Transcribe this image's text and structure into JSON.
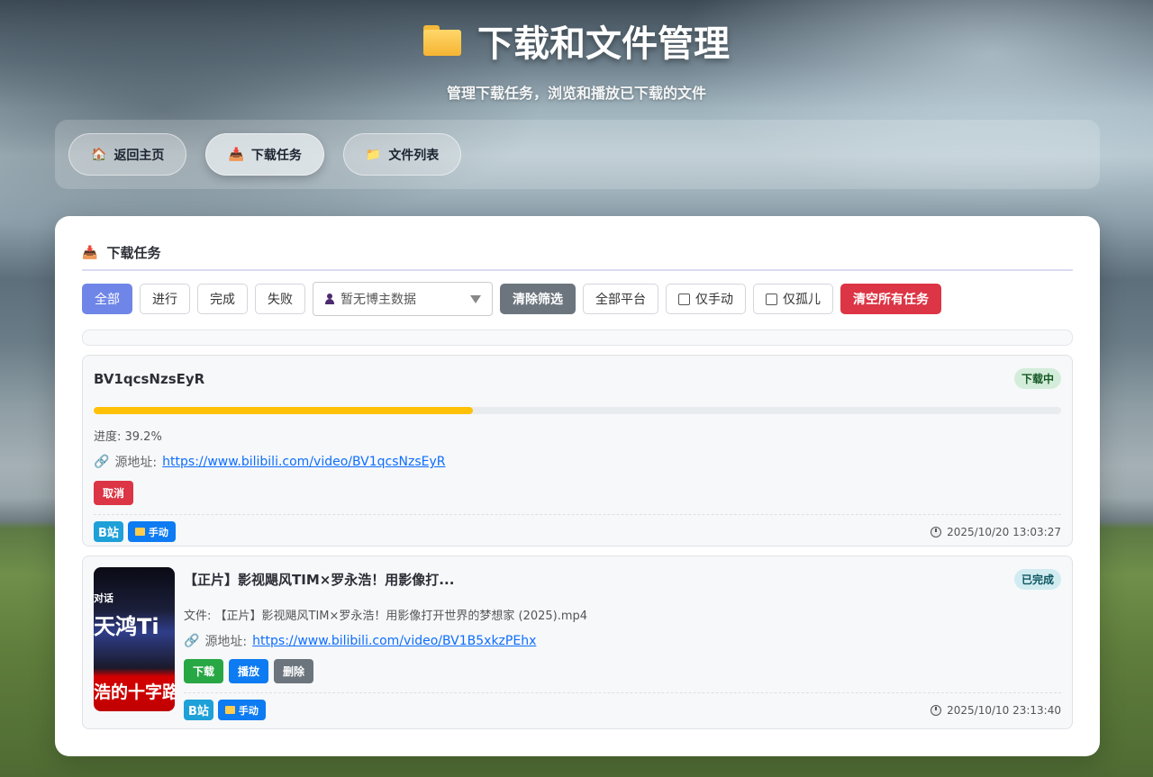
{
  "header": {
    "title": "下载和文件管理",
    "subtitle": "管理下载任务，浏览和播放已下载的文件"
  },
  "nav": {
    "items": [
      {
        "label": "返回主页",
        "icon": "house-icon"
      },
      {
        "label": "下载任务",
        "icon": "inbox-tray-icon",
        "active": true
      },
      {
        "label": "文件列表",
        "icon": "folder-icon"
      }
    ]
  },
  "panel": {
    "title": "下载任务",
    "filters": {
      "all": "全部",
      "in_progress": "进行",
      "done": "完成",
      "failed": "失败",
      "uploader_placeholder": "暂无博主数据",
      "clear_filter": "清除筛选",
      "all_platforms": "全部平台",
      "manual_only": "仅手动",
      "orphan_only": "仅孤儿",
      "clear_all": "清空所有任务"
    },
    "tasks": [
      {
        "title": "BV1qcsNzsEyR",
        "status": "下载中",
        "progress": 0.392,
        "progress_text": "进度: 39.2%",
        "source_label": "源地址:",
        "source_url": "https://www.bilibili.com/video/BV1qcsNzsEyR",
        "actions": [
          "取消"
        ],
        "platform_tag": "B站",
        "manual_tag": "手动",
        "time": "2025/10/20 13:03:27"
      },
      {
        "title": "【正片】影视飓风TIM×罗永浩！用影像打...",
        "status": "已完成",
        "file_text": "文件: 【正片】影视飓风TIM×罗永浩！用影像打开世界的梦想家 (2025).mp4",
        "source_label": "源地址:",
        "source_url": "https://www.bilibili.com/video/BV1B5xkzPEhx",
        "actions": [
          "下载",
          "播放",
          "删除"
        ],
        "platform_tag": "B站",
        "manual_tag": "手动",
        "time": "2025/10/10 23:13:40",
        "thumb_text": [
          "对话",
          "天鸿Ti",
          "浩的十字路"
        ]
      }
    ]
  }
}
